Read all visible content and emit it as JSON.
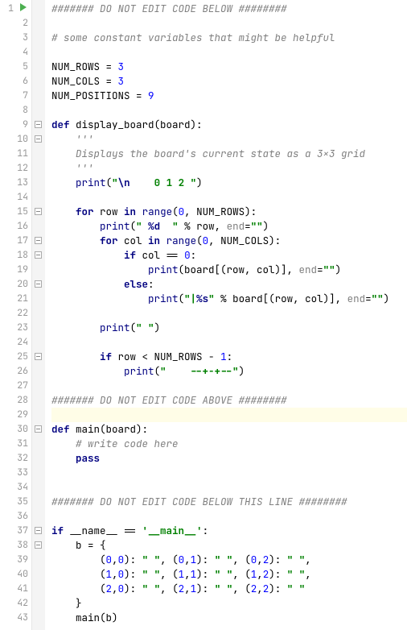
{
  "total_lines": 43,
  "run_icon_on_line": 1,
  "highlighted_line": 29,
  "fold_starts": [
    9,
    10,
    15,
    17,
    18,
    20,
    25,
    30,
    37,
    38
  ],
  "fold_ends": [
    12,
    27,
    42,
    43
  ],
  "lines": {
    "1": [
      {
        "cls": "tk-comment",
        "t": "####### DO NOT EDIT CODE BELOW ########"
      }
    ],
    "2": [],
    "3": [
      {
        "cls": "tk-comment",
        "t": "# some constant variables that might be helpful"
      }
    ],
    "4": [],
    "5": [
      {
        "cls": "tk-ident",
        "t": "NUM_ROWS "
      },
      {
        "cls": "tk-op",
        "t": "= "
      },
      {
        "cls": "tk-number",
        "t": "3"
      }
    ],
    "6": [
      {
        "cls": "tk-ident",
        "t": "NUM_COLS "
      },
      {
        "cls": "tk-op",
        "t": "= "
      },
      {
        "cls": "tk-number",
        "t": "3"
      }
    ],
    "7": [
      {
        "cls": "tk-ident",
        "t": "NUM_POSITIONS "
      },
      {
        "cls": "tk-op",
        "t": "= "
      },
      {
        "cls": "tk-number",
        "t": "9"
      }
    ],
    "8": [],
    "9": [
      {
        "cls": "tk-keyword",
        "t": "def "
      },
      {
        "cls": "tk-funcdef",
        "t": "display_board"
      },
      {
        "cls": "tk-op",
        "t": "(board):"
      }
    ],
    "10": [
      {
        "cls": "",
        "t": "    "
      },
      {
        "cls": "tk-docstr",
        "t": "'''"
      }
    ],
    "11": [
      {
        "cls": "",
        "t": "    "
      },
      {
        "cls": "tk-docstr",
        "t": "Displays the board's current state as a 3x3 grid"
      }
    ],
    "12": [
      {
        "cls": "",
        "t": "    "
      },
      {
        "cls": "tk-docstr",
        "t": "'''"
      }
    ],
    "13": [
      {
        "cls": "",
        "t": "    "
      },
      {
        "cls": "tk-builtin",
        "t": "print"
      },
      {
        "cls": "tk-op",
        "t": "("
      },
      {
        "cls": "tk-string",
        "t": "\""
      },
      {
        "cls": "tk-escape",
        "t": "\\n"
      },
      {
        "cls": "tk-string",
        "t": "    0 1 2 \""
      },
      {
        "cls": "tk-op",
        "t": ")"
      }
    ],
    "14": [],
    "15": [
      {
        "cls": "",
        "t": "    "
      },
      {
        "cls": "tk-keyword",
        "t": "for "
      },
      {
        "cls": "tk-ident",
        "t": "row "
      },
      {
        "cls": "tk-keyword",
        "t": "in "
      },
      {
        "cls": "tk-builtin",
        "t": "range"
      },
      {
        "cls": "tk-op",
        "t": "("
      },
      {
        "cls": "tk-number",
        "t": "0"
      },
      {
        "cls": "tk-op",
        "t": ", NUM_ROWS):"
      }
    ],
    "16": [
      {
        "cls": "",
        "t": "        "
      },
      {
        "cls": "tk-builtin",
        "t": "print"
      },
      {
        "cls": "tk-op",
        "t": "("
      },
      {
        "cls": "tk-string",
        "t": "\" "
      },
      {
        "cls": "tk-strfmt",
        "t": "%d"
      },
      {
        "cls": "tk-string",
        "t": "  \""
      },
      {
        "cls": "tk-op",
        "t": " % row, "
      },
      {
        "cls": "tk-param",
        "t": "end"
      },
      {
        "cls": "tk-op",
        "t": "="
      },
      {
        "cls": "tk-string",
        "t": "\"\""
      },
      {
        "cls": "tk-op",
        "t": ")"
      }
    ],
    "17": [
      {
        "cls": "",
        "t": "        "
      },
      {
        "cls": "tk-keyword",
        "t": "for "
      },
      {
        "cls": "tk-ident",
        "t": "col "
      },
      {
        "cls": "tk-keyword",
        "t": "in "
      },
      {
        "cls": "tk-builtin",
        "t": "range"
      },
      {
        "cls": "tk-op",
        "t": "("
      },
      {
        "cls": "tk-number",
        "t": "0"
      },
      {
        "cls": "tk-op",
        "t": ", NUM_COLS):"
      }
    ],
    "18": [
      {
        "cls": "",
        "t": "            "
      },
      {
        "cls": "tk-keyword",
        "t": "if "
      },
      {
        "cls": "tk-ident",
        "t": "col "
      },
      {
        "cls": "tk-op",
        "t": "== "
      },
      {
        "cls": "tk-number",
        "t": "0"
      },
      {
        "cls": "tk-op",
        "t": ":"
      }
    ],
    "19": [
      {
        "cls": "",
        "t": "                "
      },
      {
        "cls": "tk-builtin",
        "t": "print"
      },
      {
        "cls": "tk-op",
        "t": "(board[(row, col)], "
      },
      {
        "cls": "tk-param",
        "t": "end"
      },
      {
        "cls": "tk-op",
        "t": "="
      },
      {
        "cls": "tk-string",
        "t": "\"\""
      },
      {
        "cls": "tk-op",
        "t": ")"
      }
    ],
    "20": [
      {
        "cls": "",
        "t": "            "
      },
      {
        "cls": "tk-keyword",
        "t": "else"
      },
      {
        "cls": "tk-op",
        "t": ":"
      }
    ],
    "21": [
      {
        "cls": "",
        "t": "                "
      },
      {
        "cls": "tk-builtin",
        "t": "print"
      },
      {
        "cls": "tk-op",
        "t": "("
      },
      {
        "cls": "tk-string",
        "t": "\"|"
      },
      {
        "cls": "tk-strfmt",
        "t": "%s"
      },
      {
        "cls": "tk-string",
        "t": "\""
      },
      {
        "cls": "tk-op",
        "t": " % board[(row, col)], "
      },
      {
        "cls": "tk-param",
        "t": "end"
      },
      {
        "cls": "tk-op",
        "t": "="
      },
      {
        "cls": "tk-string",
        "t": "\"\""
      },
      {
        "cls": "tk-op",
        "t": ")"
      }
    ],
    "22": [],
    "23": [
      {
        "cls": "",
        "t": "        "
      },
      {
        "cls": "tk-builtin",
        "t": "print"
      },
      {
        "cls": "tk-op",
        "t": "("
      },
      {
        "cls": "tk-string",
        "t": "\" \""
      },
      {
        "cls": "tk-op",
        "t": ")"
      }
    ],
    "24": [],
    "25": [
      {
        "cls": "",
        "t": "        "
      },
      {
        "cls": "tk-keyword",
        "t": "if "
      },
      {
        "cls": "tk-ident",
        "t": "row "
      },
      {
        "cls": "tk-op",
        "t": "< NUM_ROWS - "
      },
      {
        "cls": "tk-number",
        "t": "1"
      },
      {
        "cls": "tk-op",
        "t": ":"
      }
    ],
    "26": [
      {
        "cls": "",
        "t": "            "
      },
      {
        "cls": "tk-builtin",
        "t": "print"
      },
      {
        "cls": "tk-op",
        "t": "("
      },
      {
        "cls": "tk-string",
        "t": "\"    --+-+--\""
      },
      {
        "cls": "tk-op",
        "t": ")"
      }
    ],
    "27": [],
    "28": [
      {
        "cls": "tk-comment",
        "t": "####### DO NOT EDIT CODE ABOVE ########"
      }
    ],
    "29": [],
    "30": [
      {
        "cls": "tk-keyword",
        "t": "def "
      },
      {
        "cls": "tk-funcdef",
        "t": "main"
      },
      {
        "cls": "tk-op",
        "t": "(board):"
      }
    ],
    "31": [
      {
        "cls": "",
        "t": "    "
      },
      {
        "cls": "tk-comment",
        "t": "# write code here"
      }
    ],
    "32": [
      {
        "cls": "",
        "t": "    "
      },
      {
        "cls": "tk-keyword",
        "t": "pass"
      }
    ],
    "33": [],
    "34": [],
    "35": [
      {
        "cls": "tk-comment",
        "t": "####### DO NOT EDIT CODE BELOW THIS LINE ########"
      }
    ],
    "36": [],
    "37": [
      {
        "cls": "tk-keyword",
        "t": "if "
      },
      {
        "cls": "tk-ident",
        "t": "__name__ "
      },
      {
        "cls": "tk-op",
        "t": "== "
      },
      {
        "cls": "tk-string",
        "t": "'__main__'"
      },
      {
        "cls": "tk-op",
        "t": ":"
      }
    ],
    "38": [
      {
        "cls": "",
        "t": "    "
      },
      {
        "cls": "tk-ident",
        "t": "b "
      },
      {
        "cls": "tk-op",
        "t": "= {"
      }
    ],
    "39": [
      {
        "cls": "",
        "t": "        "
      },
      {
        "cls": "tk-op",
        "t": "("
      },
      {
        "cls": "tk-number",
        "t": "0"
      },
      {
        "cls": "tk-op",
        "t": ","
      },
      {
        "cls": "tk-number",
        "t": "0"
      },
      {
        "cls": "tk-op",
        "t": "): "
      },
      {
        "cls": "tk-string",
        "t": "\" \""
      },
      {
        "cls": "tk-op",
        "t": ", ("
      },
      {
        "cls": "tk-number",
        "t": "0"
      },
      {
        "cls": "tk-op",
        "t": ","
      },
      {
        "cls": "tk-number",
        "t": "1"
      },
      {
        "cls": "tk-op",
        "t": "): "
      },
      {
        "cls": "tk-string",
        "t": "\" \""
      },
      {
        "cls": "tk-op",
        "t": ", ("
      },
      {
        "cls": "tk-number",
        "t": "0"
      },
      {
        "cls": "tk-op",
        "t": ","
      },
      {
        "cls": "tk-number",
        "t": "2"
      },
      {
        "cls": "tk-op",
        "t": "): "
      },
      {
        "cls": "tk-string",
        "t": "\" \""
      },
      {
        "cls": "tk-op",
        "t": ","
      }
    ],
    "40": [
      {
        "cls": "",
        "t": "        "
      },
      {
        "cls": "tk-op",
        "t": "("
      },
      {
        "cls": "tk-number",
        "t": "1"
      },
      {
        "cls": "tk-op",
        "t": ","
      },
      {
        "cls": "tk-number",
        "t": "0"
      },
      {
        "cls": "tk-op",
        "t": "): "
      },
      {
        "cls": "tk-string",
        "t": "\" \""
      },
      {
        "cls": "tk-op",
        "t": ", ("
      },
      {
        "cls": "tk-number",
        "t": "1"
      },
      {
        "cls": "tk-op",
        "t": ","
      },
      {
        "cls": "tk-number",
        "t": "1"
      },
      {
        "cls": "tk-op",
        "t": "): "
      },
      {
        "cls": "tk-string",
        "t": "\" \""
      },
      {
        "cls": "tk-op",
        "t": ", ("
      },
      {
        "cls": "tk-number",
        "t": "1"
      },
      {
        "cls": "tk-op",
        "t": ","
      },
      {
        "cls": "tk-number",
        "t": "2"
      },
      {
        "cls": "tk-op",
        "t": "): "
      },
      {
        "cls": "tk-string",
        "t": "\" \""
      },
      {
        "cls": "tk-op",
        "t": ","
      }
    ],
    "41": [
      {
        "cls": "",
        "t": "        "
      },
      {
        "cls": "tk-op",
        "t": "("
      },
      {
        "cls": "tk-number",
        "t": "2"
      },
      {
        "cls": "tk-op",
        "t": ","
      },
      {
        "cls": "tk-number",
        "t": "0"
      },
      {
        "cls": "tk-op",
        "t": "): "
      },
      {
        "cls": "tk-string",
        "t": "\" \""
      },
      {
        "cls": "tk-op",
        "t": ", ("
      },
      {
        "cls": "tk-number",
        "t": "2"
      },
      {
        "cls": "tk-op",
        "t": ","
      },
      {
        "cls": "tk-number",
        "t": "1"
      },
      {
        "cls": "tk-op",
        "t": "): "
      },
      {
        "cls": "tk-string",
        "t": "\" \""
      },
      {
        "cls": "tk-op",
        "t": ", ("
      },
      {
        "cls": "tk-number",
        "t": "2"
      },
      {
        "cls": "tk-op",
        "t": ","
      },
      {
        "cls": "tk-number",
        "t": "2"
      },
      {
        "cls": "tk-op",
        "t": "): "
      },
      {
        "cls": "tk-string",
        "t": "\" \""
      }
    ],
    "42": [
      {
        "cls": "",
        "t": "    "
      },
      {
        "cls": "tk-op",
        "t": "}"
      }
    ],
    "43": [
      {
        "cls": "",
        "t": "    "
      },
      {
        "cls": "tk-ident",
        "t": "main(b)"
      }
    ]
  }
}
